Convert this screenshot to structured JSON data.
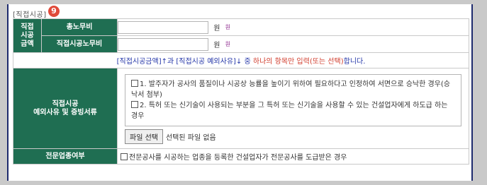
{
  "section": {
    "title": "[직접시공]",
    "badge": "9"
  },
  "direct_amount": {
    "label": "직접\n시공\n금액",
    "total_labor": {
      "label": "총노무비",
      "value": "",
      "unit": "원",
      "link": "원"
    },
    "direct_labor": {
      "label": "직접시공노무비",
      "value": "",
      "unit": "원",
      "link": "원"
    }
  },
  "notice": {
    "prefix": "[직접시공금액]↑과 [직접시공 예외사유]↓ 중 ",
    "highlight": "하나의 항목만 입력(또는 선택)",
    "suffix": "합니다."
  },
  "exception": {
    "label_line1": "직접시공",
    "label_line2": "예외사유 및 증빙서류",
    "options": [
      {
        "text": "1. 발주자가 공사의 품질이나 시공상 능률을 높이기 위하여 필요하다고 인정하여 서면으로 승낙한 경우(승낙서 첨부)",
        "checked": false
      },
      {
        "text": "2. 특허 또는 신기술이 사용되는 부분을 그 특허 또는 신기술을 사용할 수 있는 건설업자에게 하도급 하는 경우",
        "checked": false
      }
    ],
    "file_button": "파일 선택",
    "file_status": "선택된 파일 없음"
  },
  "specialty": {
    "label": "전문업종여부",
    "option": "전문공사를 시공하는 업종을 등록한 건설업자가 전문공사를 도급받은 경우",
    "checked": false
  }
}
